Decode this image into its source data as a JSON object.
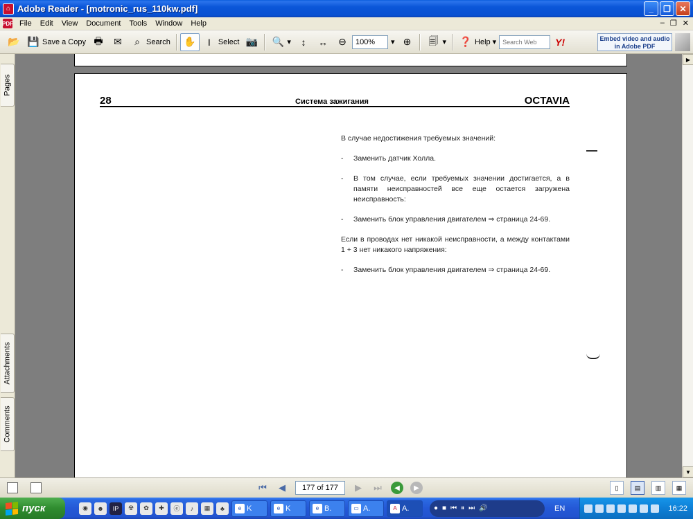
{
  "window": {
    "title": "Adobe Reader - [motronic_rus_110kw.pdf]"
  },
  "menu": {
    "items": [
      "File",
      "Edit",
      "View",
      "Document",
      "Tools",
      "Window",
      "Help"
    ]
  },
  "toolbar": {
    "save_copy": "Save a Copy",
    "search": "Search",
    "select": "Select",
    "zoom": "100%",
    "help": "Help",
    "search_web_placeholder": "Search Web",
    "embed_ad": "Embed video and audio in Adobe PDF"
  },
  "side_tabs": {
    "pages": "Pages",
    "attachments": "Attachments",
    "comments": "Comments"
  },
  "document": {
    "page_number": "28",
    "section": "Система зажигания",
    "brand": "OCTAVIA",
    "intro": "В случае недостижения требуемых значений:",
    "bullet1": "Заменить датчик Холла.",
    "bullet2": "В том случае, если требуемых значении достигается, а в памяти неисправностей все еще остается загружена неисправность:",
    "bullet3": "Заменить блок управления двигателем ⇒ страница 24-69.",
    "para2": "Если в проводах нет никакой неисправности, а между контактами 1 + 3 нет никакого напряжения:",
    "bullet4": "Заменить блок управления двигателем ⇒ страница 24-69."
  },
  "navigation": {
    "page_indicator": "177 of 177"
  },
  "taskbar": {
    "start": "пуск",
    "tasks": [
      "K",
      "K",
      "B.",
      "A.",
      "A."
    ],
    "language": "EN",
    "clock": "16:22"
  }
}
